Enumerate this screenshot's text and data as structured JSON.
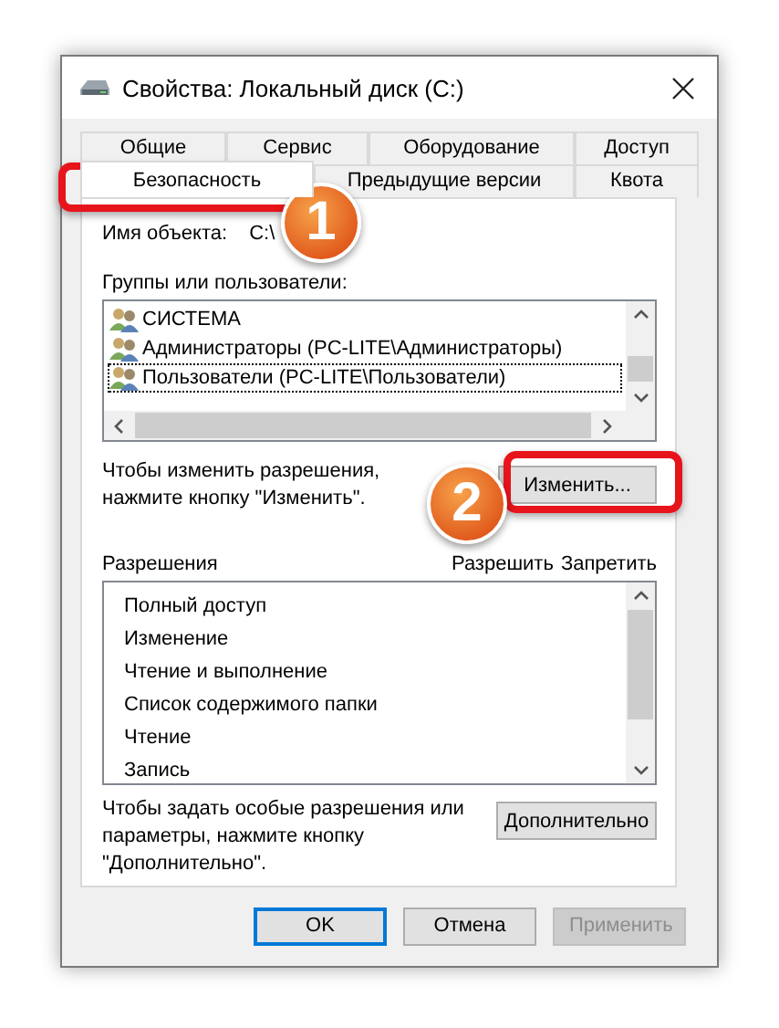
{
  "window": {
    "title": "Свойства: Локальный диск (C:)"
  },
  "tab_rows": [
    {
      "tabs": [
        {
          "label": "Общие",
          "selected": false
        },
        {
          "label": "Сервис",
          "selected": false
        },
        {
          "label": "Оборудование",
          "selected": false
        },
        {
          "label": "Доступ",
          "selected": false
        }
      ]
    },
    {
      "tabs": [
        {
          "label": "Безопасность",
          "selected": true
        },
        {
          "label": "Предыдущие версии",
          "selected": false
        },
        {
          "label": "Квота",
          "selected": false
        }
      ]
    }
  ],
  "object_name": {
    "label": "Имя объекта:",
    "value": "C:\\"
  },
  "groups": {
    "label": "Группы или пользователи:",
    "items": [
      {
        "name": "СИСТЕМА",
        "focused": false
      },
      {
        "name": "Администраторы (PC-LITE\\Администраторы)",
        "focused": false
      },
      {
        "name": "Пользователи (PC-LITE\\Пользователи)",
        "focused": true
      }
    ]
  },
  "change_hint": "Чтобы изменить разрешения,\nнажмите кнопку \"Изменить\".",
  "change_button": "Изменить...",
  "permissions": {
    "label": "Разрешения",
    "columns": [
      "Разрешить",
      "Запретить"
    ],
    "items": [
      "Полный доступ",
      "Изменение",
      "Чтение и выполнение",
      "Список содержимого папки",
      "Чтение",
      "Запись"
    ]
  },
  "advanced_hint": "Чтобы задать особые разрешения или\nпараметры, нажмите кнопку\n\"Дополнительно\".",
  "advanced_button": "Дополнительно",
  "buttons": [
    {
      "label": "OK",
      "default": true,
      "disabled": false
    },
    {
      "label": "Отмена",
      "default": false,
      "disabled": false
    },
    {
      "label": "Применить",
      "default": false,
      "disabled": true
    }
  ],
  "callouts": [
    {
      "number": "1"
    },
    {
      "number": "2"
    }
  ]
}
